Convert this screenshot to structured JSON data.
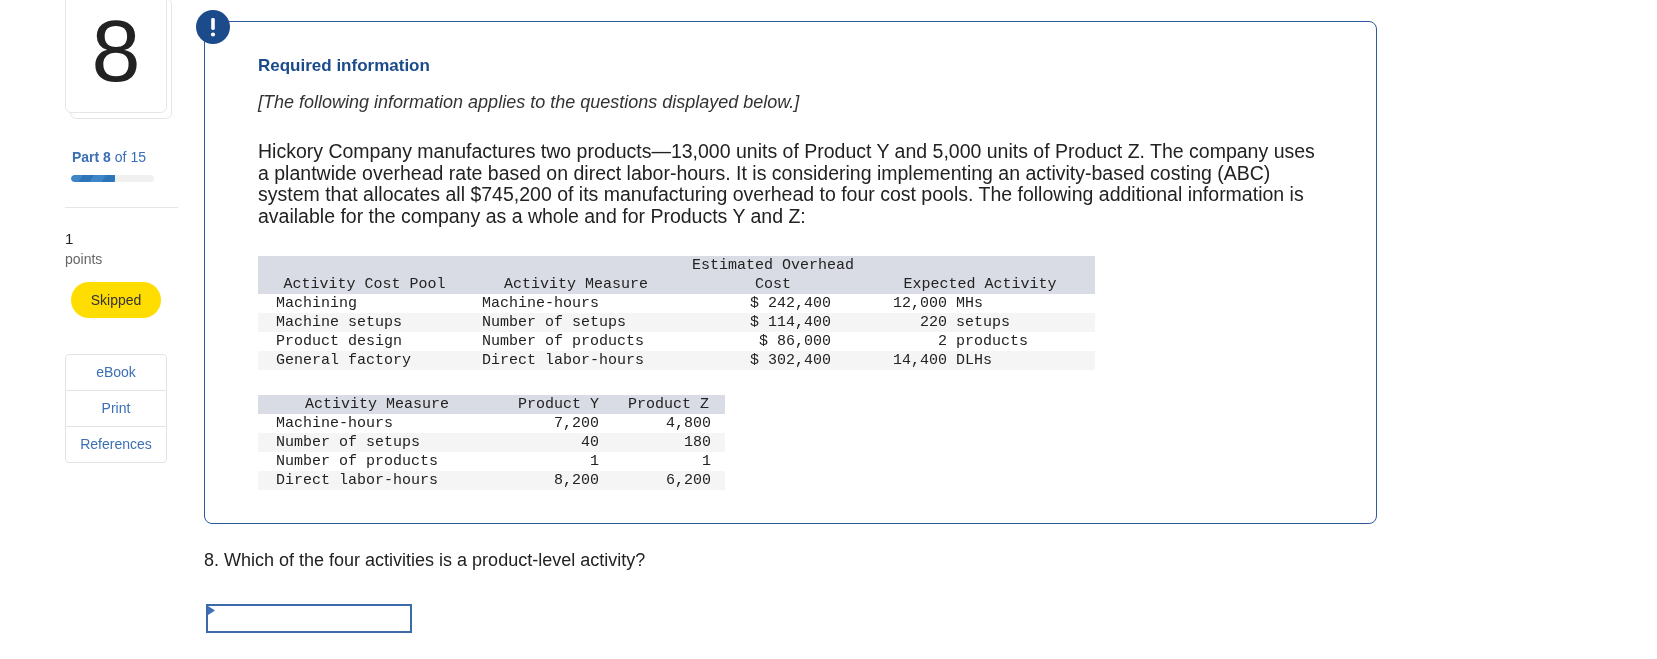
{
  "sidebar": {
    "question_number": "8",
    "part": "**Part 8** of 15",
    "progress": {
      "level": 0.53
    },
    "points_value": "1",
    "points_label": "points",
    "status": "Skipped",
    "resources": [
      {
        "label": "eBook"
      },
      {
        "label": "Print"
      },
      {
        "label": "References"
      }
    ]
  },
  "info_panel": {
    "title": "Required information",
    "note": "[The following information applies to the questions displayed below.]",
    "paragraph": "Hickory Company manufactures two products—13,000 units of Product Y and 5,000 units of Product Z. The company uses a plantwide overhead rate based on direct labor-hours. It is considering implementing an activity-based costing (ABC) system that allocates all $745,200 of its manufacturing overhead to four cost pools. The following additional information is available for the company as a whole and for Products Y and Z:",
    "cost_table": {
      "columns": [
        "Activity Cost Pool",
        "Activity Measure",
        "Estimated Overhead Cost",
        "Expected Activity"
      ],
      "rows": [
        {
          "pool": "Machining",
          "measure": "Machine-hours",
          "cost": "$ 242,400",
          "activity": "12,000",
          "unit": "MHs"
        },
        {
          "pool": "Machine setups",
          "measure": "Number of setups",
          "cost": "$ 114,400",
          "activity": "220",
          "unit": "setups"
        },
        {
          "pool": "Product design",
          "measure": "Number of products",
          "cost": "$ 86,000",
          "activity": "2",
          "unit": "products"
        },
        {
          "pool": "General factory",
          "measure": "Direct labor-hours",
          "cost": "$ 302,400",
          "activity": "14,400",
          "unit": "DLHs"
        }
      ]
    },
    "product_table": {
      "columns": [
        "Activity Measure",
        "Product Y",
        "Product Z"
      ],
      "rows": [
        {
          "measure": "Machine-hours",
          "values": [
            "7,200",
            "4,800"
          ]
        },
        {
          "measure": "Number of setups",
          "values": [
            "40",
            "180"
          ]
        },
        {
          "measure": "Number of products",
          "values": [
            "1",
            "1"
          ]
        },
        {
          "measure": "Direct labor-hours",
          "values": [
            "8,200",
            "6,200"
          ]
        }
      ]
    }
  },
  "question": {
    "text": "8. Which of the four activities is a product-level activity?"
  }
}
